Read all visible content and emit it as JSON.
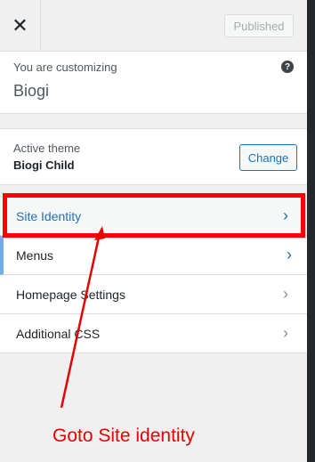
{
  "header": {
    "close_symbol": "✕",
    "published_label": "Published"
  },
  "info": {
    "customizing_label": "You are customizing",
    "site_name": "Biogi",
    "help_symbol": "?"
  },
  "theme": {
    "label": "Active theme",
    "name": "Biogi Child",
    "change_label": "Change"
  },
  "menu": {
    "items": [
      {
        "label": "Site Identity"
      },
      {
        "label": "Menus"
      },
      {
        "label": "Homepage Settings"
      },
      {
        "label": "Additional CSS"
      }
    ],
    "chevron": "›"
  },
  "annotation": {
    "text": "Goto Site identity",
    "color": "#e60000"
  },
  "colors": {
    "accent": "#2271b1",
    "highlight": "#ff0000"
  }
}
